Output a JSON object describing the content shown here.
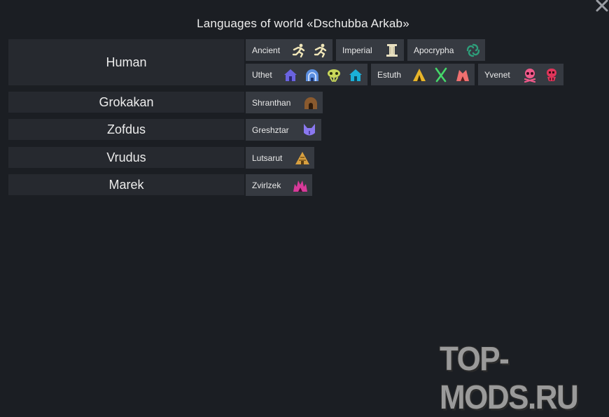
{
  "title": "Languages of world «Dschubba Arkab»",
  "races": [
    {
      "name": "Human"
    },
    {
      "name": "Grokakan"
    },
    {
      "name": "Zofdus"
    },
    {
      "name": "Vrudus"
    },
    {
      "name": "Marek"
    }
  ],
  "languages": [
    {
      "name": "Ancient",
      "icons": [
        "running-figure-icon",
        "running-figure-icon"
      ],
      "color": "#f0e6b8"
    },
    {
      "name": "Imperial",
      "icons": [
        "pillar-icon"
      ],
      "color": "#e8e0c0"
    },
    {
      "name": "Apocrypha",
      "icons": [
        "swirl-icon"
      ],
      "color": "#2e9e7a"
    },
    {
      "name": "Uthet",
      "icons": [
        "house-icon",
        "dome-icon",
        "skull-icon",
        "house-icon"
      ],
      "colors": [
        "#6a63e0",
        "#5b8fe0",
        "#c9d85a",
        "#1bb0d8"
      ]
    },
    {
      "name": "Estuth",
      "icons": [
        "tent-icon",
        "crossed-bones-icon",
        "hut-icon"
      ],
      "colors": [
        "#e8b52a",
        "#45d86a",
        "#f07070"
      ]
    },
    {
      "name": "Yvenet",
      "icons": [
        "skull-icon",
        "skull-icon"
      ],
      "colors": [
        "#f05a8a",
        "#e0355a"
      ]
    },
    {
      "name": "Shranthan",
      "icons": [
        "dome-icon"
      ],
      "color": "#8a5a2e"
    },
    {
      "name": "Greshztar",
      "icons": [
        "cat-head-icon"
      ],
      "color": "#8a78f0"
    },
    {
      "name": "Lutsarut",
      "icons": [
        "pyramid-icon"
      ],
      "color": "#d8a040"
    },
    {
      "name": "Zvirlzek",
      "icons": [
        "spiky-hut-icon"
      ],
      "color": "#d83a9a"
    }
  ],
  "watermark": "TOP-MODS.RU"
}
